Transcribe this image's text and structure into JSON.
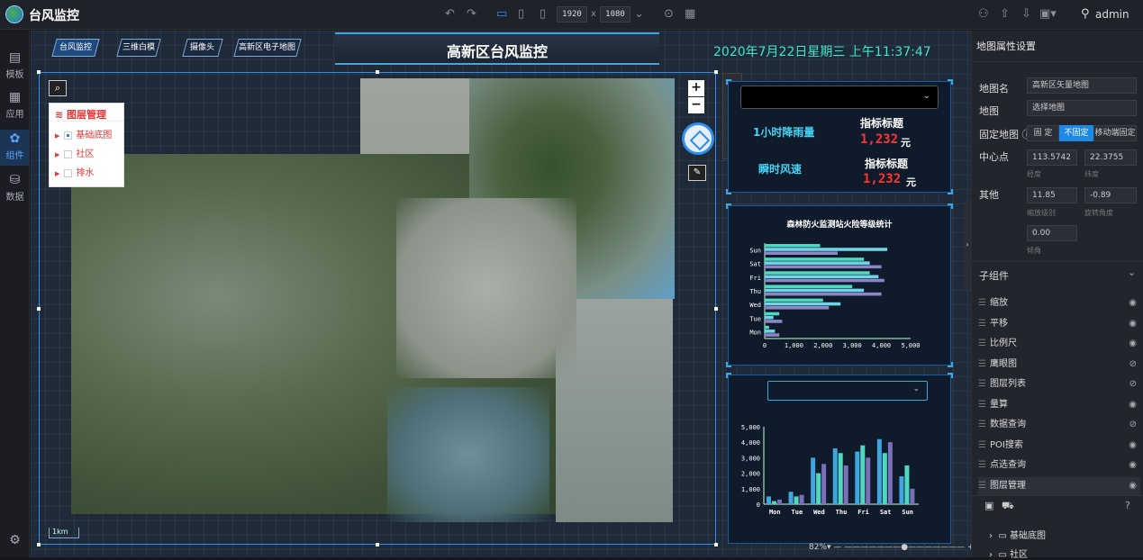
{
  "app": {
    "title": "台风监控",
    "user": "admin",
    "width_value": "1920",
    "height_value": "1080",
    "times": "x"
  },
  "left_nav": [
    {
      "label": "模板",
      "icon": "layout-icon"
    },
    {
      "label": "应用",
      "icon": "grid-icon"
    },
    {
      "label": "组件",
      "icon": "component-icon"
    },
    {
      "label": "数据",
      "icon": "database-icon"
    }
  ],
  "nav_tabs": [
    "台风监控",
    "三维白模",
    "摄像头",
    "高新区电子地图"
  ],
  "dashboard": {
    "title": "高新区台风监控",
    "datetime": "2020年7月22日星期三 上午11:37:47"
  },
  "layer_panel": {
    "title": "图层管理",
    "items": [
      {
        "label": "基础底图",
        "checked": true
      },
      {
        "label": "社区",
        "checked": false
      },
      {
        "label": "排水",
        "checked": false
      }
    ]
  },
  "scale": "1km",
  "kpis": [
    {
      "label": "1小时降雨量",
      "title": "指标标题",
      "value": "1,232",
      "unit": "元"
    },
    {
      "label": "瞬时风速",
      "title": "指标标题",
      "value": "1,232",
      "unit": "元"
    }
  ],
  "chart_data": [
    {
      "type": "bar",
      "title": "森林防火监测站火险等级统计",
      "orientation": "horizontal",
      "categories": [
        "Mon",
        "Tue",
        "Wed",
        "Thu",
        "Fri",
        "Sat",
        "Sun"
      ],
      "series": [
        {
          "values": [
            150,
            500,
            2000,
            3000,
            3600,
            3400,
            1900
          ]
        },
        {
          "values": [
            350,
            300,
            2600,
            3400,
            3900,
            3600,
            4200
          ]
        },
        {
          "values": [
            500,
            600,
            2200,
            4000,
            4100,
            4000,
            2500
          ]
        }
      ],
      "xlim": [
        0,
        5000
      ],
      "xticks": [
        "0",
        "1,000",
        "2,000",
        "3,000",
        "4,000",
        "5,000"
      ],
      "colors": [
        "#4dd9c0",
        "#6fd4e8",
        "#8a86c8"
      ]
    },
    {
      "type": "bar",
      "title": "",
      "categories": [
        "Mon",
        "Tue",
        "Wed",
        "Thu",
        "Fri",
        "Sat",
        "Sun"
      ],
      "series": [
        {
          "values": [
            500,
            800,
            3000,
            3600,
            3400,
            4200,
            1800
          ]
        },
        {
          "values": [
            200,
            500,
            2000,
            3300,
            3800,
            3300,
            2500
          ]
        },
        {
          "values": [
            300,
            600,
            2600,
            2500,
            3000,
            4000,
            1000
          ]
        }
      ],
      "ylim": [
        0,
        5000
      ],
      "yticks": [
        "0",
        "1,000",
        "2,000",
        "3,000",
        "4,000",
        "5,000"
      ],
      "colors": [
        "#3fa6e0",
        "#4dd9c0",
        "#7a6fb8"
      ]
    }
  ],
  "zoom": {
    "percent": "82%"
  },
  "right_panel": {
    "title": "地图属性设置",
    "map_name_label": "地图名",
    "map_name_value": "高新区矢量地图",
    "map_label": "地图",
    "map_value": "选择地图",
    "fixed_label": "固定地图",
    "fixed_options": [
      "固 定",
      "不固定",
      "移动端固定"
    ],
    "fixed_selected": 1,
    "center_label": "中心点",
    "lng": "113.5742",
    "lat": "22.3755",
    "lng_label": "经度",
    "lat_label": "纬度",
    "other_label": "其他",
    "zoom_level": "11.85",
    "rotation": "-0.89",
    "zoom_level_label": "缩放级别",
    "rotation_label": "旋转角度",
    "pitch": "0.00",
    "pitch_label": "倾角",
    "children_label": "子组件",
    "children": [
      "缩放",
      "平移",
      "比例尺",
      "鹰眼图",
      "图层列表",
      "量算",
      "数据查询",
      "POI搜索",
      "点选查询",
      "图层管理"
    ],
    "children_hidden": [
      false,
      false,
      false,
      true,
      true,
      false,
      true,
      false,
      false,
      false
    ],
    "tree": [
      "基础底图",
      "社区"
    ]
  }
}
